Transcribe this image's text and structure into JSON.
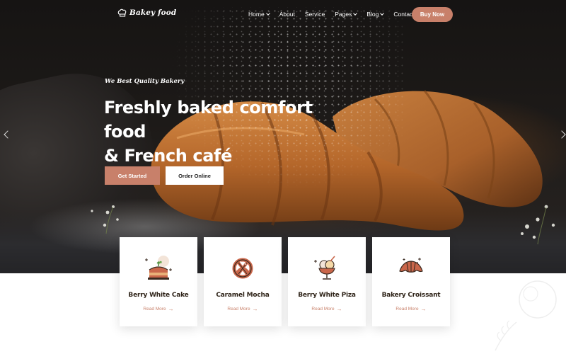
{
  "brand": {
    "name": "Bakey food"
  },
  "nav": {
    "items": [
      {
        "label": "Home",
        "has_dropdown": true
      },
      {
        "label": "About",
        "has_dropdown": false
      },
      {
        "label": "Service",
        "has_dropdown": false
      },
      {
        "label": "Pages",
        "has_dropdown": true
      },
      {
        "label": "Blog",
        "has_dropdown": true
      },
      {
        "label": "Contact",
        "has_dropdown": false
      }
    ],
    "cta_label": "Buy Now"
  },
  "hero": {
    "tagline": "We Best Quality Bakery",
    "headline_line1": "Freshly baked comfort food",
    "headline_line2": "& French café",
    "primary_button": "Get Started",
    "secondary_button": "Order Online"
  },
  "features": [
    {
      "title": "Berry White Cake",
      "link": "Read More",
      "icon": "cake-icon"
    },
    {
      "title": "Caramel Mocha",
      "link": "Read More",
      "icon": "pretzel-icon"
    },
    {
      "title": "Berry White Piza",
      "link": "Read More",
      "icon": "ice-cream-icon"
    },
    {
      "title": "Bakery Croissant",
      "link": "Read More",
      "icon": "croissant-icon"
    }
  ],
  "colors": {
    "accent": "#c8806a",
    "hero_dark": "#1b1817",
    "text_dark": "#2e2318"
  }
}
